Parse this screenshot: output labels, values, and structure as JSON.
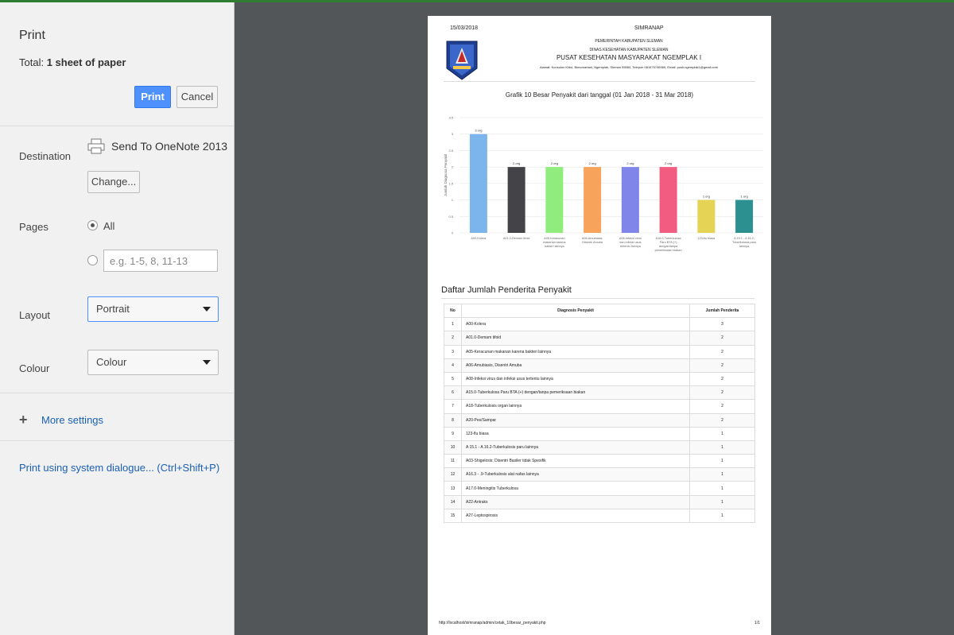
{
  "sidebar": {
    "title": "Print",
    "total_label": "Total: ",
    "total_value": "1 sheet of paper",
    "print_label": "Print",
    "cancel_label": "Cancel",
    "destination": {
      "label": "Destination",
      "name": "Send To OneNote 2013",
      "change_label": "Change..."
    },
    "pages": {
      "label": "Pages",
      "all_label": "All",
      "custom_placeholder": "e.g. 1-5, 8, 11-13"
    },
    "layout": {
      "label": "Layout",
      "value": "Portrait"
    },
    "colour": {
      "label": "Colour",
      "value": "Colour"
    },
    "more_settings": "More settings",
    "system_dialog": "Print using system dialogue... (Ctrl+Shift+P)"
  },
  "doc": {
    "date": "15/03/2018",
    "app": "SIMRANAP",
    "header_line1": "PEMERINTAH KABUPATEN SLEMAN",
    "header_line2": "DINAS KESEHATAN KABUPATEN SLEMAN",
    "header_line3": "PUSAT KESEHATAN MASYARAKAT NGEMPLAK I",
    "header_line4": "Alamat: Konsulon Kidul, Bimomartani, Ngemplak, Sleman 55584, Telepon 081575746969, Email: pusk.ngemplak1@gmail.com",
    "chart_title": "Grafik 10 Besar Penyakit dari tanggal (01 Jan 2018 - 31 Mar 2018)",
    "list_title": "Daftar Jumlah Penderita Penyakit",
    "table_headers": [
      "No",
      "Diagnosis Penyakit",
      "Jumlah Penderita"
    ],
    "rows": [
      [
        "1",
        "A00-Kolera",
        "3"
      ],
      [
        "2",
        "A01.0-Demam tifoid",
        "2"
      ],
      [
        "3",
        "A05-Keracunan makanan karena bakteri lainnya",
        "2"
      ],
      [
        "4",
        "A06-Amubiasis, Disentri Amuba",
        "2"
      ],
      [
        "5",
        "A08-Infeksi virus dan infeksi usus tertentu lainnya",
        "2"
      ],
      [
        "6",
        "A15.0-Tuberkulosa Paru BTA (+) dengan/tanpa pemeriksaan biakan",
        "2"
      ],
      [
        "7",
        "A18-Tuberkulosis organ lainnya",
        "2"
      ],
      [
        "8",
        "A20-Pes/Sampar",
        "2"
      ],
      [
        "9",
        "123-flu biasa",
        "1"
      ],
      [
        "10",
        "A 15.1 - A 16.2-Tuberkulosis paru lainnya",
        "1"
      ],
      [
        "11",
        "A03-Shigelosis; Disentri Basiler tidak Spesifik",
        "1"
      ],
      [
        "12",
        "A16.3 - .9-Tuberkulosis alat nafas lainnya",
        "1"
      ],
      [
        "13",
        "A17.0-Meningitis Tuberkulosa",
        "1"
      ],
      [
        "14",
        "A22-Antraks",
        "1"
      ],
      [
        "15",
        "A27-Leptospirosis",
        "1"
      ]
    ],
    "footer_url": "http://localhost/simranap/admin/cetak_10besar_penyakit.php",
    "footer_page": "1/1"
  },
  "chart_data": {
    "type": "bar",
    "title": "Grafik 10 Besar Penyakit dari tanggal (01 Jan 2018 - 31 Mar 2018)",
    "ylabel": "Jumlah Diagnosa Penyakit",
    "ylim": [
      0,
      3.5
    ],
    "yticks": [
      "0",
      "0.5",
      "1",
      "1.5",
      "2",
      "2.5",
      "3",
      "3.5"
    ],
    "categories": [
      [
        "A00-Kolera"
      ],
      [
        "A01.0-Demam tifoid"
      ],
      [
        "A05-Keracunan",
        "makanan karena",
        "bakteri lainnya"
      ],
      [
        "A06-Amubiasis,",
        "Disentri Amuba"
      ],
      [
        "A08-Infeksi virus",
        "dan infeksi usus",
        "tertentu lainnya"
      ],
      [
        "A15.0-Tuberkulosa",
        "Paru BTA (+)",
        "dengan/tanpa",
        "pemeriksaan biakan"
      ],
      [
        "123-flu biasa"
      ],
      [
        "A 15.1 - A 16.2-",
        "Tuberkulosis paru",
        "lainnya"
      ]
    ],
    "values": [
      3,
      2,
      2,
      2,
      2,
      2,
      1,
      1
    ],
    "data_labels": [
      "3 org",
      "2 org",
      "2 org",
      "2 org",
      "2 org",
      "2 org",
      "1 org",
      "1 org"
    ],
    "colors": [
      "#7cb5ec",
      "#434348",
      "#90ed7d",
      "#f7a35c",
      "#8085e9",
      "#f15c80",
      "#e4d354",
      "#2b908f"
    ]
  }
}
